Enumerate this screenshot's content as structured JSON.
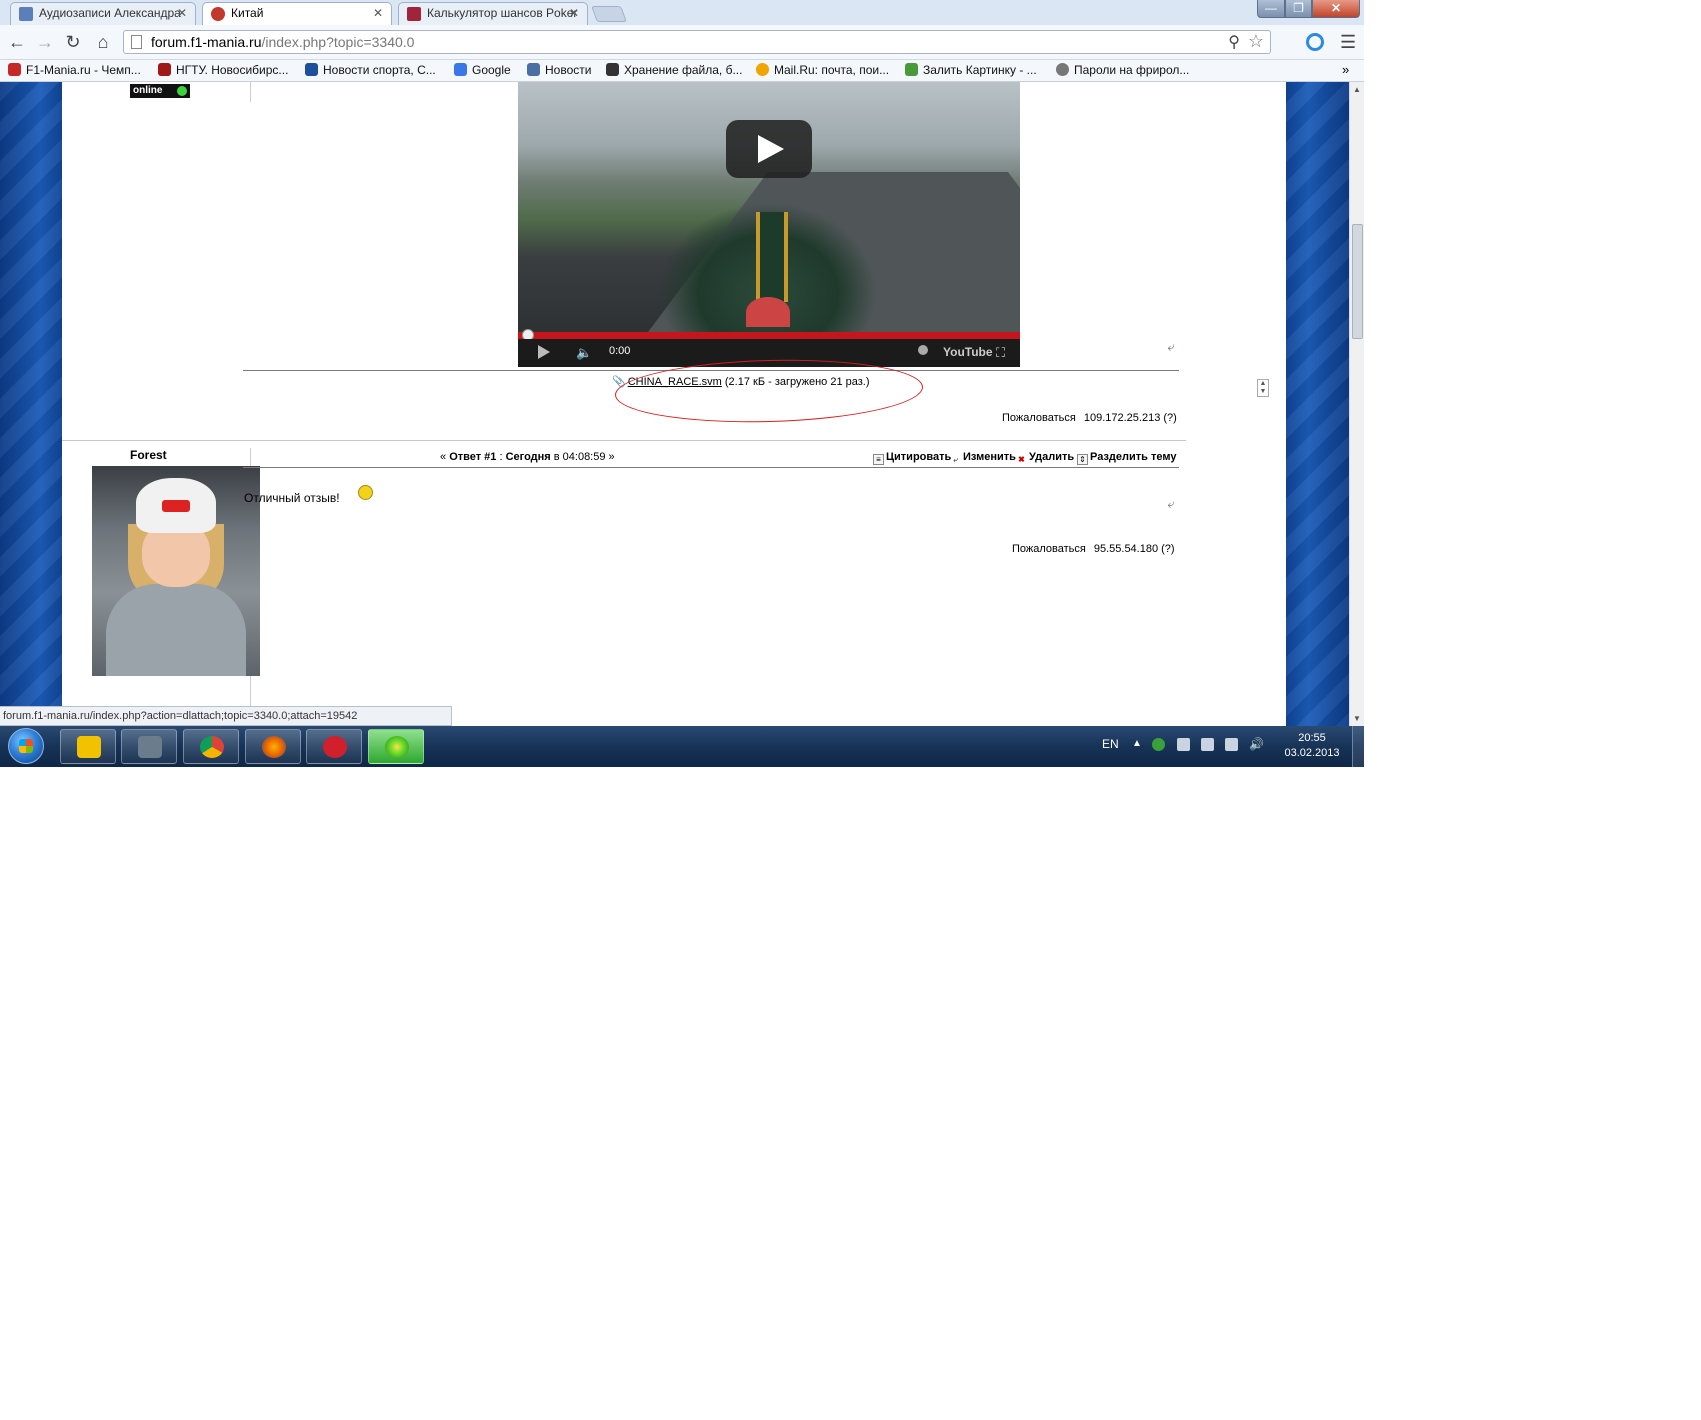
{
  "browser": {
    "tabs": [
      {
        "label": "Аудиозаписи Александра",
        "color": "#5b7fb8"
      },
      {
        "label": "Китай",
        "color": "#c0392b"
      },
      {
        "label": "Калькулятор шансов Poker",
        "color": "#a0253a"
      }
    ],
    "close_glyph": "✕",
    "url_host": "forum.f1-mania.ru",
    "url_path": "/index.php?topic=3340.0",
    "bookmarks": [
      {
        "label": "F1-Mania.ru - Чемп...",
        "color": "#c62828"
      },
      {
        "label": "НГТУ. Новосибирс...",
        "color": "#a01818"
      },
      {
        "label": "Новости спорта, С...",
        "color": "#1e4f9c"
      },
      {
        "label": "Google",
        "color": "#3b78e7"
      },
      {
        "label": "Новости",
        "color": "#4a6fa5"
      },
      {
        "label": "Хранение файла, б...",
        "color": "#333333"
      },
      {
        "label": "Mail.Ru: почта, пои...",
        "color": "#f0a500"
      },
      {
        "label": "Залить Картинку - ...",
        "color": "#4a9a3a"
      },
      {
        "label": "Пароли на фрирол...",
        "color": "#777777"
      }
    ],
    "bookmarks_more": "»",
    "status_url": "forum.f1-mania.ru/index.php?action=dlattach;topic=3340.0;attach=19542"
  },
  "post1": {
    "online": "online",
    "video": {
      "time": "0:00",
      "brand": "YouTube"
    },
    "attachment": {
      "file": "CHINA_RACE.svm",
      "info": " (2.17 кБ - загружено 21 раз.)"
    },
    "report_label": "Пожаловаться",
    "ip": "109.172.25.213 (?)"
  },
  "post2": {
    "author": "Forest",
    "meta_prefix": "« ",
    "meta_reply": "Ответ #1",
    "meta_sep": " : ",
    "meta_day": "Сегодня",
    "meta_at": " в 04:08:59 »",
    "actions": {
      "quote": "Цитировать",
      "edit": "Изменить",
      "delete": "Удалить",
      "split": "Разделить тему"
    },
    "body": "Отличный отзыв!",
    "report_label": "Пожаловаться",
    "ip": "95.55.54.180 (?)"
  },
  "taskbar": {
    "lang": "EN",
    "time": "20:55",
    "date": "03.02.2013"
  }
}
